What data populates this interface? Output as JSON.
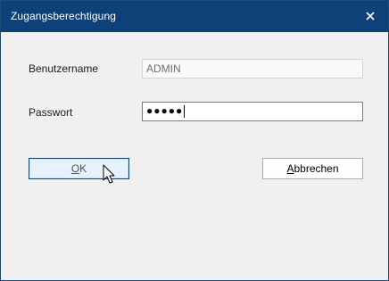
{
  "window": {
    "title": "Zugangsberechtigung",
    "close_icon": "close-icon"
  },
  "form": {
    "username_label": "Benutzername",
    "username_value": "ADMIN",
    "password_label": "Passwort",
    "password_masked": "●●●●●"
  },
  "buttons": {
    "ok": {
      "mnemonic": "O",
      "rest": "K"
    },
    "cancel": {
      "mnemonic": "A",
      "rest": "bbrechen"
    }
  },
  "colors": {
    "titlebar": "#0d4177",
    "dialog_bg": "#f0f0f0",
    "default_button_border": "#0d4177"
  },
  "pointer": {
    "icon": "mouse-pointer-icon"
  }
}
